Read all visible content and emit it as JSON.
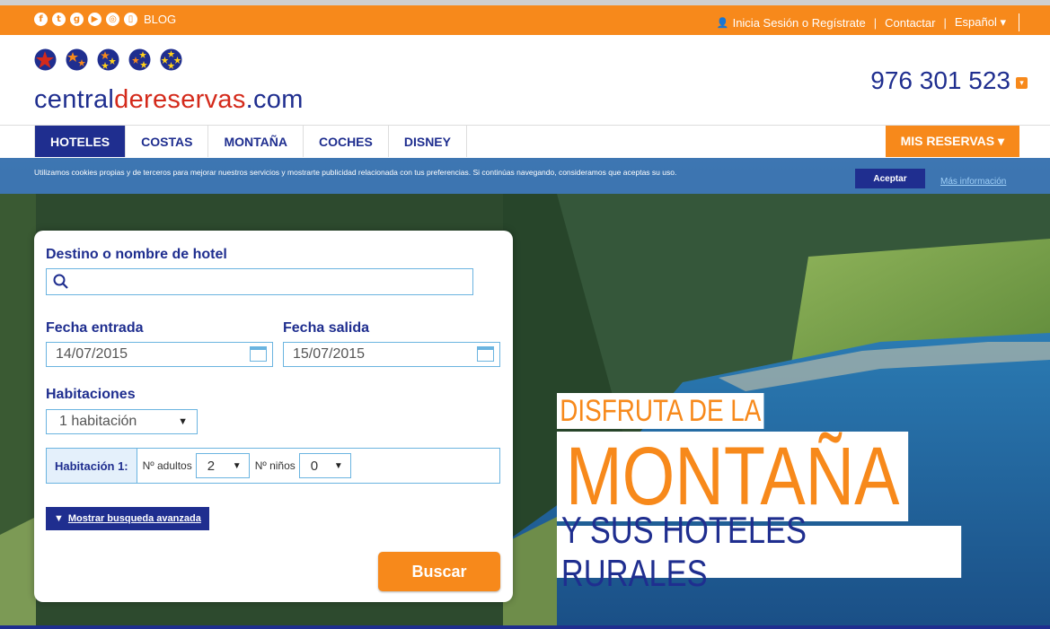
{
  "topbar": {
    "social_icons": [
      "facebook-icon",
      "twitter-icon",
      "google-plus-icon",
      "youtube-icon",
      "instagram-icon",
      "phone-app-icon"
    ],
    "blog_label": "BLOG",
    "login_label": "Inicia Sesión o Regístrate",
    "contact_label": "Contactar",
    "language_label": "Español ▾"
  },
  "header": {
    "logo_part1": "central",
    "logo_part2": "dereservas",
    "logo_part3": ".com",
    "phone": "976 301 523"
  },
  "nav": {
    "items": [
      "HOTELES",
      "COSTAS",
      "MONTAÑA",
      "COCHES",
      "DISNEY"
    ],
    "my_bookings": "MIS RESERVAS ▾"
  },
  "cookie": {
    "text": "Utilizamos cookies propias y de terceros para mejorar nuestros servicios y mostrarte publicidad relacionada con tus preferencias. Si continúas navegando, consideramos que aceptas su uso.",
    "accept": "Aceptar",
    "more_info": "Más información"
  },
  "search": {
    "destination_label": "Destino o nombre de hotel",
    "destination_value": "",
    "checkin_label": "Fecha entrada",
    "checkin_value": "14/07/2015",
    "checkout_label": "Fecha salida",
    "checkout_value": "15/07/2015",
    "rooms_label": "Habitaciones",
    "rooms_value": "1 habitación",
    "room1_label": "Habitación 1:",
    "adults_label": "Nº adultos",
    "adults_value": "2",
    "children_label": "Nº niños",
    "children_value": "0",
    "advanced_label": "Mostrar busqueda avanzada",
    "submit": "Buscar"
  },
  "promo": {
    "line1": "DISFRUTA DE LA",
    "line2": "MONTAÑA",
    "line3": "Y SUS HOTELES RURALES"
  },
  "colors": {
    "brand_orange": "#f7891b",
    "brand_blue": "#1f2e8f",
    "logo_red": "#d42a1b"
  }
}
